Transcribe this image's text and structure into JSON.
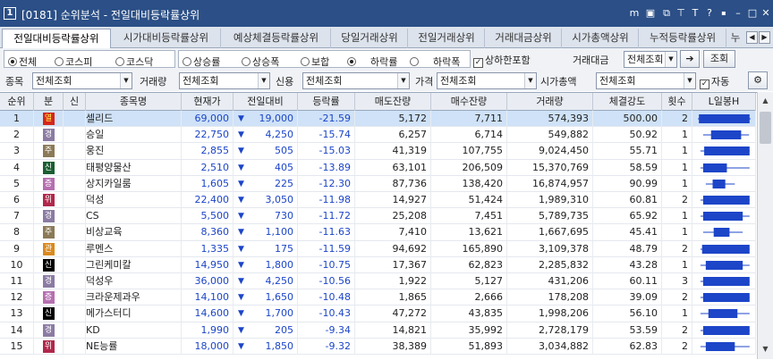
{
  "window": {
    "title": "[0181] 순위분석 - 전일대비등락률상위",
    "icon_glyph": "1"
  },
  "tabs": [
    "전일대비등락률상위",
    "시가대비등락률상위",
    "예상체결등락률상위",
    "당일거래상위",
    "전일거래상위",
    "거래대금상위",
    "시가총액상위",
    "누적등락률상위",
    "누"
  ],
  "filter1": {
    "market_options": [
      "전체",
      "코스피",
      "코스닥"
    ],
    "market_selected": "전체",
    "direction_options": [
      "상승률",
      "상승폭",
      "보합",
      "하락률",
      "하락폭"
    ],
    "direction_selected": "하락률",
    "limit_check_label": "상하한포함",
    "limit_checked": true,
    "amount_label": "거래대금",
    "amount_value": "전체조회",
    "query_button": "조회"
  },
  "filter2": {
    "item_label": "종목",
    "item_value": "전체조회",
    "volume_label": "거래량",
    "volume_value": "전체조회",
    "credit_label": "신용",
    "credit_value": "전체조회",
    "price_label": "가격",
    "price_value": "전체조회",
    "cap_label": "시가총액",
    "cap_value": "전체조회",
    "auto_label": "자동",
    "auto_checked": true
  },
  "grid": {
    "headers": [
      "순위",
      "분",
      "신",
      "종목명",
      "현재가",
      "전일대비",
      "등락률",
      "매도잔량",
      "매수잔량",
      "거래량",
      "체결강도",
      "횟수",
      "L일봉H"
    ],
    "badge_colors": {
      "열": "#d4261b",
      "경": "#8b7ba3",
      "주": "#8b7a58",
      "신": "#1a5e32",
      "증": "#b56fb0",
      "위": "#b0284b",
      "관": "#d98a1f",
      "신_black": "#000000"
    },
    "rows": [
      {
        "rank": "1",
        "badge": "열",
        "badge_color": "#d4261b",
        "badge_text_color": "#ffee44",
        "name": "셀리드",
        "price": "69,000",
        "change": "19,000",
        "rate": "-21.59",
        "sell": "5,172",
        "buy": "7,711",
        "volume": "574,393",
        "strength": "500.00",
        "count": "2",
        "bar": {
          "lo": 0.0,
          "hi": 1.0,
          "o": 0.02,
          "c": 0.98
        }
      },
      {
        "rank": "2",
        "badge": "경",
        "badge_color": "#8b7ba3",
        "badge_text_color": "#ffffff",
        "name": "승일",
        "price": "22,750",
        "change": "4,250",
        "rate": "-15.74",
        "sell": "6,257",
        "buy": "6,714",
        "volume": "549,882",
        "strength": "50.92",
        "count": "1",
        "bar": {
          "lo": 0.1,
          "hi": 0.97,
          "o": 0.25,
          "c": 0.82
        }
      },
      {
        "rank": "3",
        "badge": "주",
        "badge_color": "#8b7a58",
        "badge_text_color": "#ffffff",
        "name": "웅진",
        "price": "2,855",
        "change": "505",
        "rate": "-15.03",
        "sell": "41,319",
        "buy": "107,755",
        "volume": "9,024,450",
        "strength": "55.71",
        "count": "1",
        "bar": {
          "lo": 0.05,
          "hi": 0.98,
          "o": 0.12,
          "c": 0.98
        }
      },
      {
        "rank": "4",
        "badge": "신",
        "badge_color": "#1a5e32",
        "badge_text_color": "#ffffff",
        "name": "태평양물산",
        "price": "2,510",
        "change": "405",
        "rate": "-13.89",
        "sell": "63,101",
        "buy": "206,509",
        "volume": "15,370,769",
        "strength": "58.59",
        "count": "1",
        "bar": {
          "lo": 0.05,
          "hi": 0.98,
          "o": 0.1,
          "c": 0.55
        }
      },
      {
        "rank": "5",
        "badge": "증",
        "badge_color": "#b56fb0",
        "badge_text_color": "#ffffff",
        "name": "상지카일룸",
        "price": "1,605",
        "change": "225",
        "rate": "-12.30",
        "sell": "87,736",
        "buy": "138,420",
        "volume": "16,874,957",
        "strength": "90.99",
        "count": "1",
        "bar": {
          "lo": 0.15,
          "hi": 0.7,
          "o": 0.28,
          "c": 0.52
        }
      },
      {
        "rank": "6",
        "badge": "위",
        "badge_color": "#b0284b",
        "badge_text_color": "#ffffff",
        "name": "덕성",
        "price": "22,400",
        "change": "3,050",
        "rate": "-11.98",
        "sell": "14,927",
        "buy": "51,424",
        "volume": "1,989,310",
        "strength": "60.81",
        "count": "2",
        "bar": {
          "lo": 0.05,
          "hi": 0.98,
          "o": 0.1,
          "c": 0.98
        }
      },
      {
        "rank": "7",
        "badge": "경",
        "badge_color": "#8b7ba3",
        "badge_text_color": "#ffffff",
        "name": "CS",
        "price": "5,500",
        "change": "730",
        "rate": "-11.72",
        "sell": "25,208",
        "buy": "7,451",
        "volume": "5,789,735",
        "strength": "65.92",
        "count": "1",
        "bar": {
          "lo": 0.05,
          "hi": 0.98,
          "o": 0.1,
          "c": 0.85
        }
      },
      {
        "rank": "8",
        "badge": "주",
        "badge_color": "#8b7a58",
        "badge_text_color": "#ffffff",
        "name": "비상교육",
        "price": "8,360",
        "change": "1,100",
        "rate": "-11.63",
        "sell": "7,410",
        "buy": "13,621",
        "volume": "1,667,695",
        "strength": "45.41",
        "count": "1",
        "bar": {
          "lo": 0.1,
          "hi": 0.85,
          "o": 0.3,
          "c": 0.6
        }
      },
      {
        "rank": "9",
        "badge": "관",
        "badge_color": "#d98a1f",
        "badge_text_color": "#ffffff",
        "name": "루멘스",
        "price": "1,335",
        "change": "175",
        "rate": "-11.59",
        "sell": "94,692",
        "buy": "165,890",
        "volume": "3,109,378",
        "strength": "48.79",
        "count": "2",
        "bar": {
          "lo": 0.05,
          "hi": 0.98,
          "o": 0.08,
          "c": 0.98
        }
      },
      {
        "rank": "10",
        "badge": "신",
        "badge_color": "#000000",
        "badge_text_color": "#ffffff",
        "name": "그린케미칼",
        "price": "14,950",
        "change": "1,800",
        "rate": "-10.75",
        "sell": "17,367",
        "buy": "62,823",
        "volume": "2,285,832",
        "strength": "43.28",
        "count": "1",
        "bar": {
          "lo": 0.05,
          "hi": 0.98,
          "o": 0.15,
          "c": 0.85
        }
      },
      {
        "rank": "11",
        "badge": "경",
        "badge_color": "#8b7ba3",
        "badge_text_color": "#ffffff",
        "name": "덕성우",
        "price": "36,000",
        "change": "4,250",
        "rate": "-10.56",
        "sell": "1,922",
        "buy": "5,127",
        "volume": "431,206",
        "strength": "60.11",
        "count": "3",
        "bar": {
          "lo": 0.05,
          "hi": 0.98,
          "o": 0.1,
          "c": 0.98
        }
      },
      {
        "rank": "12",
        "badge": "증",
        "badge_color": "#b56fb0",
        "badge_text_color": "#ffffff",
        "name": "크라운제과우",
        "price": "14,100",
        "change": "1,650",
        "rate": "-10.48",
        "sell": "1,865",
        "buy": "2,666",
        "volume": "178,208",
        "strength": "39.09",
        "count": "2",
        "bar": {
          "lo": 0.05,
          "hi": 0.98,
          "o": 0.1,
          "c": 0.98
        }
      },
      {
        "rank": "13",
        "badge": "신",
        "badge_color": "#000000",
        "badge_text_color": "#ffffff",
        "name": "메가스터디",
        "price": "14,600",
        "change": "1,700",
        "rate": "-10.43",
        "sell": "47,272",
        "buy": "43,835",
        "volume": "1,998,206",
        "strength": "56.10",
        "count": "1",
        "bar": {
          "lo": 0.05,
          "hi": 0.98,
          "o": 0.2,
          "c": 0.75
        }
      },
      {
        "rank": "14",
        "badge": "경",
        "badge_color": "#8b7ba3",
        "badge_text_color": "#ffffff",
        "name": "KD",
        "price": "1,990",
        "change": "205",
        "rate": "-9.34",
        "sell": "14,821",
        "buy": "35,992",
        "volume": "2,728,179",
        "strength": "53.59",
        "count": "2",
        "bar": {
          "lo": 0.05,
          "hi": 0.98,
          "o": 0.1,
          "c": 0.98
        }
      },
      {
        "rank": "15",
        "badge": "위",
        "badge_color": "#b0284b",
        "badge_text_color": "#ffffff",
        "name": "NE능률",
        "price": "18,000",
        "change": "1,850",
        "rate": "-9.32",
        "sell": "38,389",
        "buy": "51,893",
        "volume": "3,034,882",
        "strength": "62.83",
        "count": "2",
        "bar": {
          "lo": 0.05,
          "hi": 0.98,
          "o": 0.15,
          "c": 0.7
        }
      }
    ]
  },
  "scroll": {
    "position": 0.0
  }
}
